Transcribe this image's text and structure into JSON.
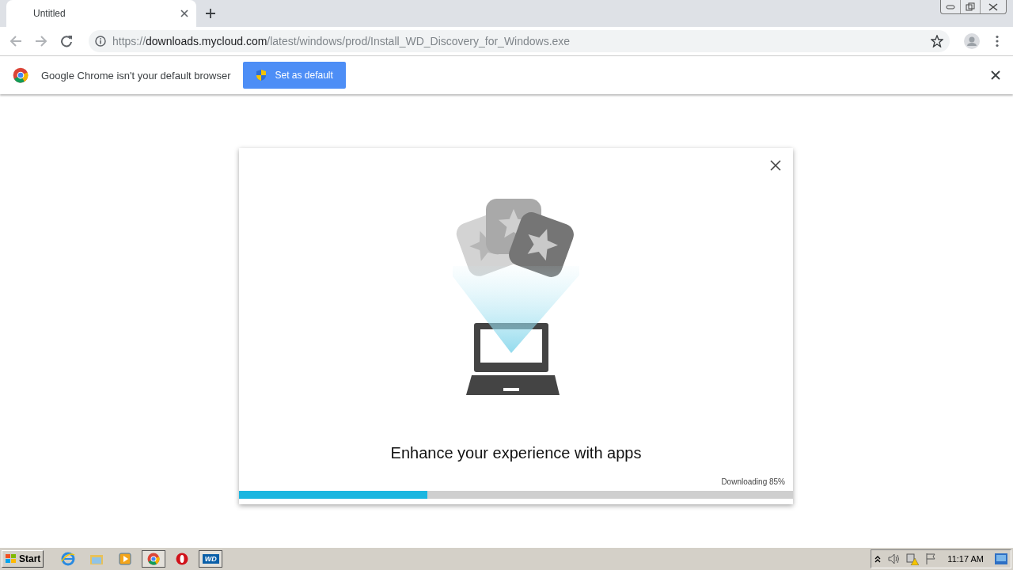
{
  "tab": {
    "title": "Untitled",
    "selected": true
  },
  "address_bar": {
    "scheme": "https://",
    "host": "downloads.mycloud.com",
    "path": "/latest/windows/prod/Install_WD_Discovery_for_Windows.exe"
  },
  "infobar": {
    "message": "Google Chrome isn't your default browser",
    "button": "Set as default"
  },
  "dialog": {
    "heading": "Enhance your experience with apps",
    "status": "Downloading 85%",
    "progress": {
      "level": 0.34
    }
  },
  "taskbar": {
    "start": "Start",
    "apps": [
      {
        "kind": "ie",
        "selected": false
      },
      {
        "kind": "folder",
        "selected": false
      },
      {
        "kind": "media",
        "selected": false
      },
      {
        "kind": "chrome",
        "selected": true
      },
      {
        "kind": "opera",
        "selected": false
      },
      {
        "kind": "wd",
        "label": "WD",
        "selected": true
      }
    ],
    "clock": "11:17 AM"
  }
}
